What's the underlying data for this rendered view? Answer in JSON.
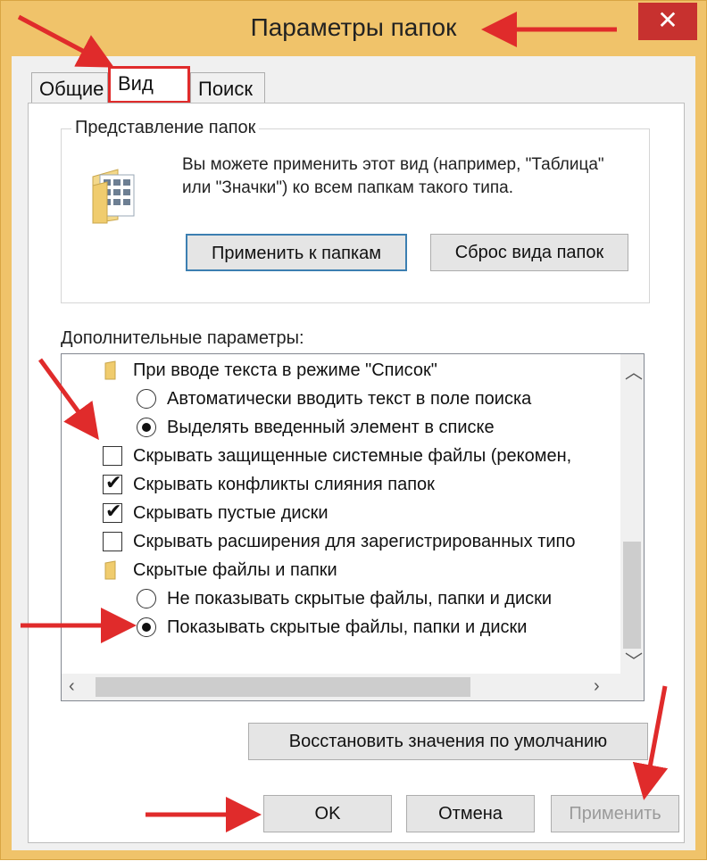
{
  "window": {
    "title": "Параметры папок",
    "close_glyph": "✕"
  },
  "tabs": [
    {
      "label": "Общие",
      "active": false
    },
    {
      "label": "Вид",
      "active": true
    },
    {
      "label": "Поиск",
      "active": false
    }
  ],
  "folder_views": {
    "group_title": "Представление папок",
    "description": "Вы можете применить этот вид (например, \"Таблица\" или \"Значки\") ко всем папкам такого типа.",
    "icon": "folder-grid-icon",
    "apply_button": "Применить к папкам",
    "reset_button": "Сброс вида папок"
  },
  "advanced": {
    "label": "Дополнительные параметры:",
    "items": [
      {
        "type": "folder",
        "label": "При вводе текста в режиме \"Список\"",
        "indent": 0
      },
      {
        "type": "radio",
        "label": "Автоматически вводить текст в поле поиска",
        "checked": false,
        "indent": 1
      },
      {
        "type": "radio",
        "label": "Выделять введенный элемент в списке",
        "checked": true,
        "indent": 1
      },
      {
        "type": "checkbox",
        "label": "Скрывать защищенные системные файлы (рекомен,",
        "checked": false,
        "indent": 0
      },
      {
        "type": "checkbox",
        "label": "Скрывать конфликты слияния папок",
        "checked": true,
        "indent": 0
      },
      {
        "type": "checkbox",
        "label": "Скрывать пустые диски",
        "checked": true,
        "indent": 0
      },
      {
        "type": "checkbox",
        "label": "Скрывать расширения для зарегистрированных типо",
        "checked": false,
        "indent": 0
      },
      {
        "type": "folder",
        "label": "Скрытые файлы и папки",
        "indent": 0
      },
      {
        "type": "radio",
        "label": "Не показывать скрытые файлы, папки и диски",
        "checked": false,
        "indent": 1
      },
      {
        "type": "radio",
        "label": "Показывать скрытые файлы, папки и диски",
        "checked": true,
        "indent": 1
      }
    ]
  },
  "restore_button": "Восстановить значения по умолчанию",
  "footer": {
    "ok": "OK",
    "cancel": "Отмена",
    "apply": "Применить"
  },
  "colors": {
    "frame": "#f0c36a",
    "close": "#c7312f",
    "annotation": "#e02b2b",
    "focus": "#3c7fb1"
  }
}
